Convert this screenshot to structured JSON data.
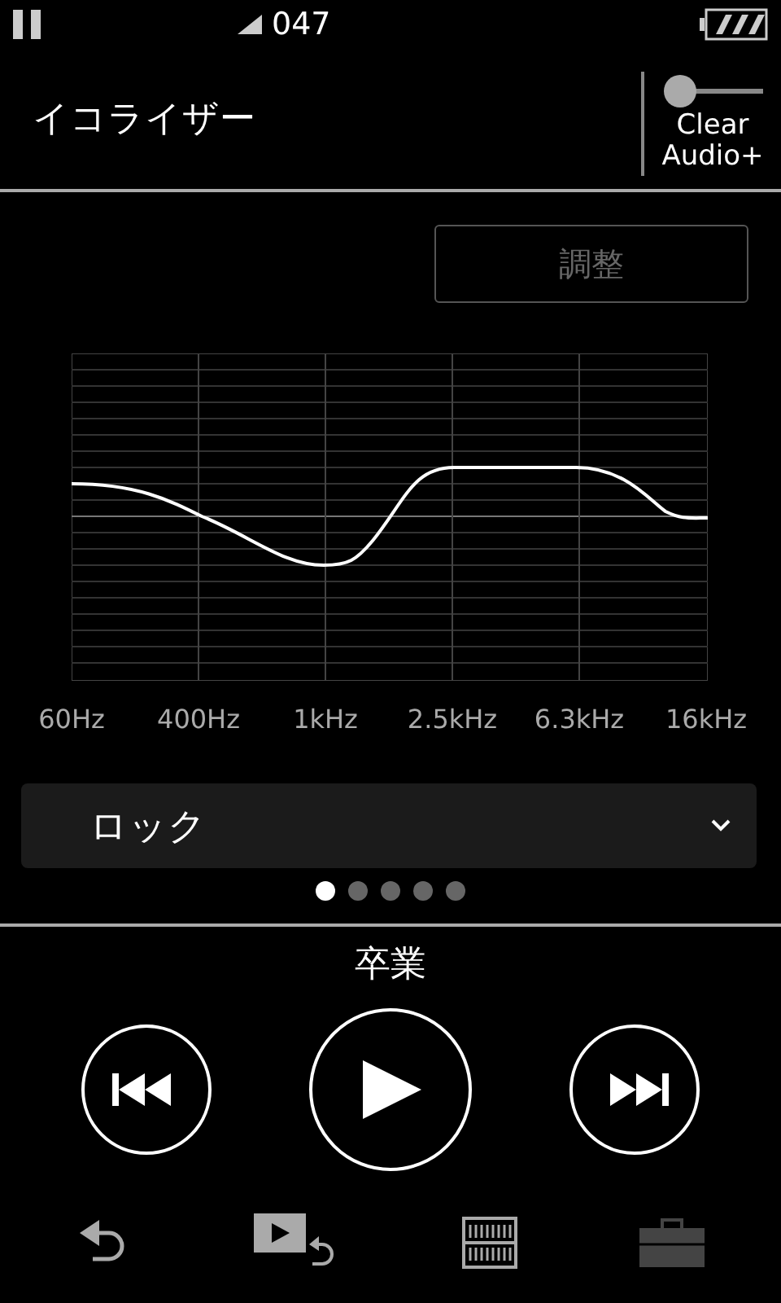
{
  "status_bar": {
    "signal_label": "047"
  },
  "header": {
    "title": "イコライザー",
    "clear_audio": {
      "label_line1": "Clear",
      "label_line2": "Audio+",
      "on": false
    }
  },
  "adjust_button": {
    "label": "調整",
    "disabled": true
  },
  "equalizer": {
    "bands": [
      "60Hz",
      "400Hz",
      "1kHz",
      "2.5kHz",
      "6.3kHz",
      "16kHz"
    ]
  },
  "preset": {
    "value": "ロック"
  },
  "pages": [
    {
      "selected": true
    },
    {
      "selected": false
    },
    {
      "selected": false
    },
    {
      "selected": false
    },
    {
      "selected": false
    }
  ],
  "track": {
    "title": "卒業"
  },
  "nav": [
    {
      "kind": "back"
    },
    {
      "kind": "video"
    },
    {
      "kind": "library"
    },
    {
      "kind": "tools"
    }
  ]
}
